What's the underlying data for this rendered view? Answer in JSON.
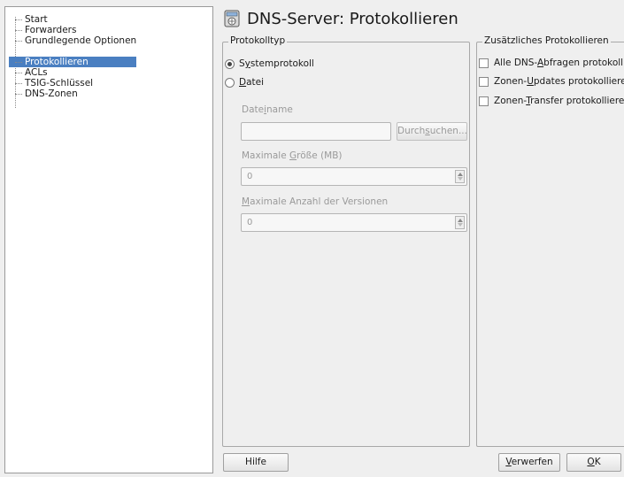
{
  "sidebar": {
    "items": [
      {
        "label": "Start"
      },
      {
        "label": "Forwarders"
      },
      {
        "label": "Grundlegende Optionen"
      },
      {
        "label": "Protokollieren",
        "selected": true
      },
      {
        "label": "ACLs"
      },
      {
        "label": "TSIG-Schlüssel"
      },
      {
        "label": "DNS-Zonen"
      }
    ]
  },
  "header": {
    "title": "DNS-Server: Protokollieren",
    "icon": "dns-server-icon"
  },
  "protokolltyp": {
    "title": "Protokolltyp",
    "systemprotokoll": {
      "pre": "S",
      "accel": "y",
      "post": "stemprotokoll",
      "checked": true
    },
    "datei": {
      "pre": "",
      "accel": "D",
      "post": "atei",
      "checked": false
    },
    "dateiname_label": {
      "pre": "Date",
      "accel": "i",
      "post": "name"
    },
    "dateiname_value": "",
    "browse_button": {
      "pre": "Durch",
      "accel": "s",
      "post": "uchen..."
    },
    "max_size_label": {
      "pre": "Maximale ",
      "accel": "G",
      "post": "röße (MB)"
    },
    "max_size_value": "0",
    "max_versions_label": {
      "pre": "",
      "accel": "M",
      "post": "aximale Anzahl der Versionen"
    },
    "max_versions_value": "0"
  },
  "extra": {
    "title": "Zusätzliches Protokollieren",
    "options": [
      {
        "pre": "Alle DNS-",
        "accel": "A",
        "post": "bfragen protokollie",
        "checked": false
      },
      {
        "pre": "Zonen-",
        "accel": "U",
        "post": "pdates protokollieren",
        "checked": false
      },
      {
        "pre": "Zonen-",
        "accel": "T",
        "post": "ransfer protokollieren",
        "checked": false
      }
    ]
  },
  "buttons": {
    "help": "Hilfe",
    "discard": {
      "pre": "",
      "accel": "V",
      "post": "erwerfen"
    },
    "ok": {
      "pre": "",
      "accel": "O",
      "post": "K"
    }
  },
  "colors": {
    "selection": "#4a7fc1",
    "background": "#efefef"
  }
}
